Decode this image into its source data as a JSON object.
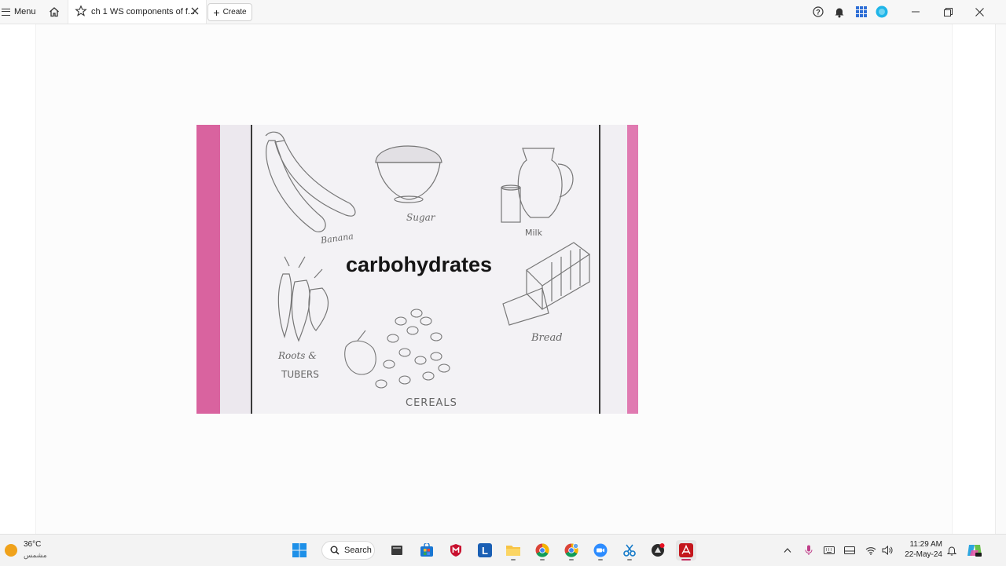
{
  "app": {
    "menu_label": "Menu",
    "tab_title": "ch 1 WS components of f...",
    "create_label": "Create"
  },
  "figure": {
    "main_label": "carbohydrates",
    "item_labels": {
      "banana": "Banana",
      "sugar": "Sugar",
      "milk": "Milk",
      "roots": "Roots &",
      "tubers": "TUBERS",
      "bread": "Bread",
      "cereals": "CEREALS"
    },
    "colors": {
      "left_border": "#d9639f",
      "right_border": "#e07ab1"
    }
  },
  "taskbar": {
    "weather_temp": "36°C",
    "weather_condition": "مشمس",
    "search_label": "Search",
    "time": "11:29 AM",
    "date": "22-May-24",
    "apps": [
      "windows-start",
      "file-explorer-files",
      "microsoft-store",
      "mcafee",
      "l-app",
      "file-explorer",
      "chrome",
      "chrome-2",
      "zoom",
      "snipping-tool",
      "app-dark",
      "adobe-acrobat"
    ]
  }
}
